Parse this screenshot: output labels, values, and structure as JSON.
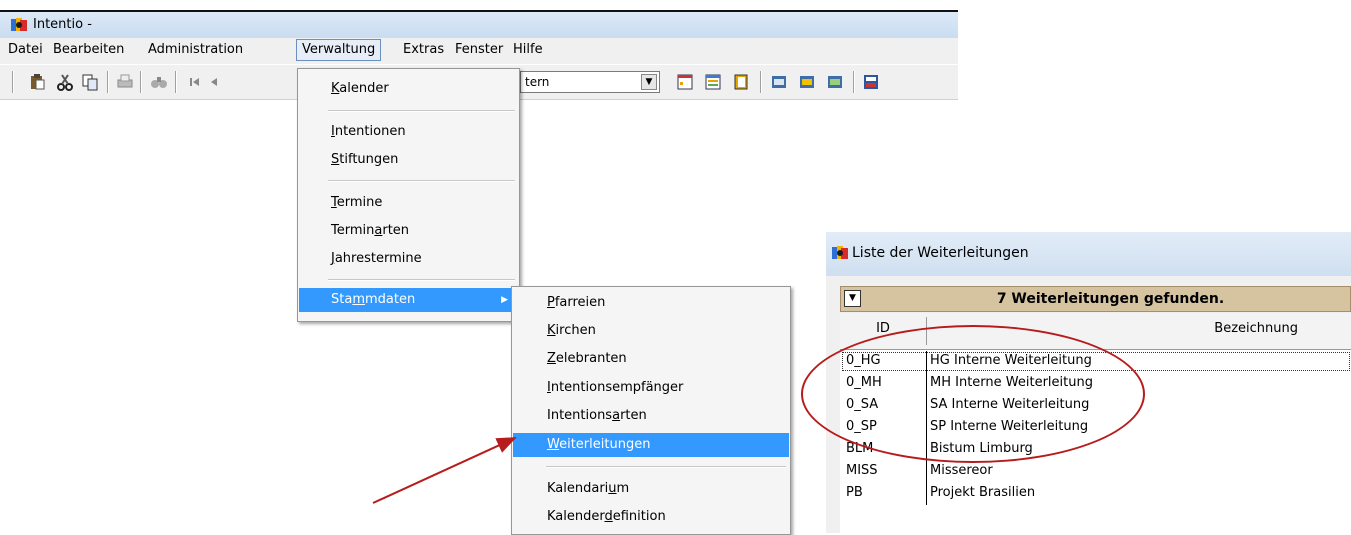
{
  "window": {
    "title": "Intentio -"
  },
  "menubar": [
    "Datei",
    "Bearbeiten",
    "Administration",
    "Verwaltung",
    "Extras",
    "Fenster",
    "Hilfe"
  ],
  "toolbar": {
    "combo_value": "tern"
  },
  "menu_verwaltung": {
    "kalender": {
      "u": "K",
      "rest": "alender"
    },
    "intentionen": {
      "u": "I",
      "rest": "ntentionen"
    },
    "stiftungen": {
      "u": "S",
      "rest": "tiftungen"
    },
    "termine": {
      "u": "T",
      "rest": "ermine"
    },
    "terminarten": {
      "pre": "Termin",
      "u": "a",
      "rest": "rten"
    },
    "jahrestermine": {
      "u": "J",
      "rest": "ahrestermine"
    },
    "stammdaten": {
      "pre": "Sta",
      "u": "m",
      "rest": "mdaten"
    }
  },
  "menu_stammdaten": {
    "pfarreien": {
      "u": "P",
      "rest": "farreien"
    },
    "kirchen": {
      "u": "K",
      "rest": "irchen"
    },
    "zelebranten": {
      "u": "Z",
      "rest": "elebranten"
    },
    "intentionsempfaenger": {
      "u": "I",
      "rest": "ntentionsempfänger"
    },
    "intentionsarten": {
      "pre": "Intentions",
      "u": "a",
      "rest": "rten"
    },
    "weiterleitungen": {
      "u": "W",
      "rest": "eiterleitungen"
    },
    "kalendarium": {
      "pre": "Kalendari",
      "u": "u",
      "rest": "m"
    },
    "kalenderdefinition": {
      "pre": "Kalender",
      "u": "d",
      "rest": "efinition"
    }
  },
  "dialog": {
    "title": "Liste der Weiterleitungen",
    "status": "7 Weiterleitungen gefunden.",
    "col_id": "ID",
    "col_bez": "Bezeichnung",
    "rows": [
      {
        "id": "0_HG",
        "bez": "HG Interne Weiterleitung"
      },
      {
        "id": "0_MH",
        "bez": "MH Interne Weiterleitung"
      },
      {
        "id": "0_SA",
        "bez": "SA Interne Weiterleitung"
      },
      {
        "id": "0_SP",
        "bez": "SP Interne Weiterleitung"
      },
      {
        "id": "BLM",
        "bez": "Bistum Limburg"
      },
      {
        "id": "MISS",
        "bez": "Missereor"
      },
      {
        "id": "PB",
        "bez": "Projekt Brasilien"
      }
    ]
  },
  "colors": {
    "highlight": "#3399ff",
    "annotation": "#b71c1c",
    "status_bg": "#d6c4a0"
  }
}
